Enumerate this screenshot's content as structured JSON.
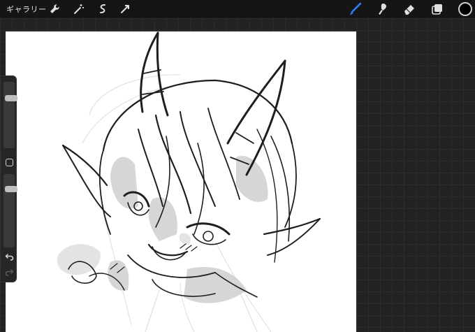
{
  "topbar": {
    "gallery_label": "ギャラリー",
    "left_tools": [
      "wrench-icon",
      "magic-wand-icon",
      "selection-icon",
      "transform-icon"
    ],
    "right_tools": [
      "brush-icon",
      "smudge-icon",
      "eraser-icon",
      "layers-icon"
    ],
    "active_tool": "brush-icon",
    "accent_color": "#2f7df6",
    "current_color": "#000000"
  },
  "sidebar": {
    "size_slider_level": 0.22,
    "opacity_slider_level": 0.18,
    "icons": [
      "modify-square-icon",
      "undo-icon",
      "redo-icon"
    ]
  },
  "canvas": {
    "background": "#ffffff"
  }
}
